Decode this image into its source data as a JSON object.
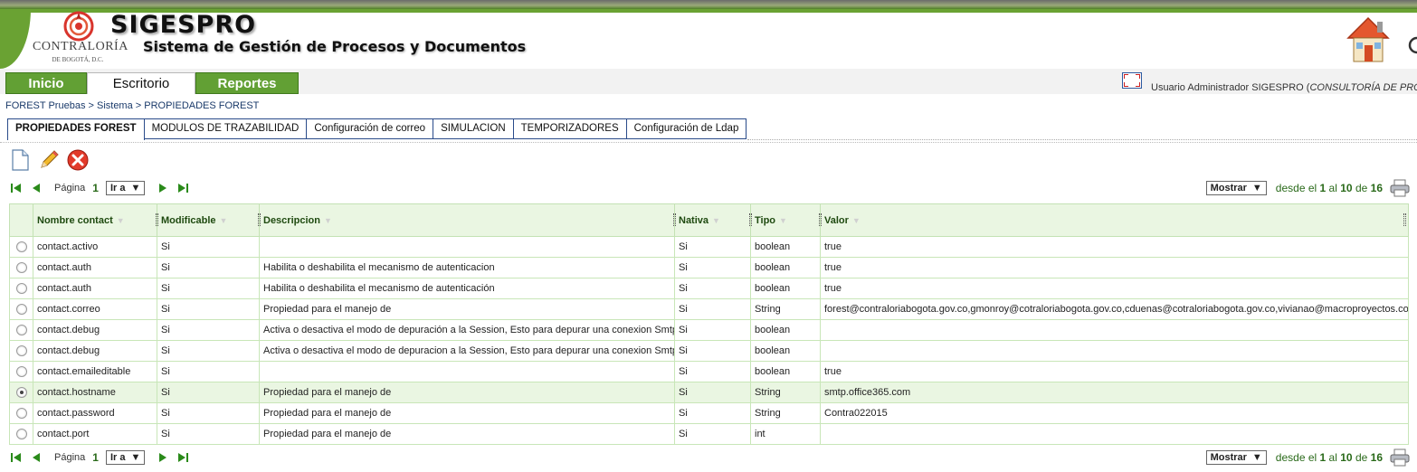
{
  "header": {
    "logo_name": "CONTRALORÍA",
    "logo_sub": "DE BOGOTÁ, D.C.",
    "app_title": "SIGESPRO",
    "app_subtitle": "Sistema de Gestión de Procesos y Documentos"
  },
  "nav": {
    "tabs": [
      {
        "label": "Inicio"
      },
      {
        "label": "Escritorio"
      },
      {
        "label": "Reportes"
      }
    ],
    "user_text": "Usuario Administrador SIGESPRO (",
    "user_role": "CONSULTORÍA DE PRO"
  },
  "breadcrumb": "FOREST Pruebas > Sistema > PROPIEDADES FOREST",
  "subtabs": [
    {
      "label": "PROPIEDADES FOREST"
    },
    {
      "label": "MODULOS DE TRAZABILIDAD"
    },
    {
      "label": "Configuración de correo"
    },
    {
      "label": "SIMULACION"
    },
    {
      "label": "TEMPORIZADORES"
    },
    {
      "label": "Configuración de Ldap"
    }
  ],
  "pager": {
    "page_label": "Página",
    "page_number": "1",
    "goto_label": "Ir a",
    "show_label": "Mostrar",
    "from_label": "desde el",
    "from": "1",
    "to_label": "al",
    "to": "10",
    "of_label": "de",
    "total": "16"
  },
  "table": {
    "columns": [
      "Nombre contact",
      "Modificable",
      "Descripcion",
      "Nativa",
      "Tipo",
      "Valor"
    ],
    "rows": [
      {
        "selected": false,
        "cells": [
          "contact.activo",
          "Si",
          "",
          "Si",
          "boolean",
          "true"
        ]
      },
      {
        "selected": false,
        "cells": [
          "contact.auth",
          "Si",
          "Habilita o deshabilita el mecanismo de autenticacion",
          "Si",
          "boolean",
          "true"
        ]
      },
      {
        "selected": false,
        "cells": [
          "contact.auth",
          "Si",
          "Habilita o deshabilita el mecanismo de autenticación",
          "Si",
          "boolean",
          "true"
        ]
      },
      {
        "selected": false,
        "cells": [
          "contact.correo",
          "Si",
          "Propiedad para el manejo de",
          "Si",
          "String",
          "forest@contraloriabogota.gov.co,gmonroy@cotraloriabogota.gov.co,cduenas@cotraloriabogota.gov.co,vivianao@macroproyectos.com"
        ]
      },
      {
        "selected": false,
        "cells": [
          "contact.debug",
          "Si",
          "Activa o desactiva el modo de depuración a la Session, Esto para depurar una conexion Smtp",
          "Si",
          "boolean",
          ""
        ]
      },
      {
        "selected": false,
        "cells": [
          "contact.debug",
          "Si",
          "Activa o desactiva el modo de depuracion a la Session, Esto para depurar una conexion Smtp",
          "Si",
          "boolean",
          ""
        ]
      },
      {
        "selected": false,
        "cells": [
          "contact.emaileditable",
          "Si",
          "",
          "Si",
          "boolean",
          "true"
        ]
      },
      {
        "selected": true,
        "cells": [
          "contact.hostname",
          "Si",
          "Propiedad para el manejo de",
          "Si",
          "String",
          "smtp.office365.com"
        ]
      },
      {
        "selected": false,
        "cells": [
          "contact.password",
          "Si",
          "Propiedad para el manejo de",
          "Si",
          "String",
          "Contra022015"
        ]
      },
      {
        "selected": false,
        "cells": [
          "contact.port",
          "Si",
          "Propiedad para el manejo de",
          "Si",
          "int",
          ""
        ]
      }
    ]
  },
  "icons": {
    "home": "home-icon",
    "new": "new-document-icon",
    "edit": "pencil-icon",
    "delete": "delete-icon",
    "print": "printer-icon"
  },
  "colors": {
    "brand_green": "#62a034",
    "header_row_bg": "#eaf6e2",
    "link_blue": "#1a3a6a"
  }
}
